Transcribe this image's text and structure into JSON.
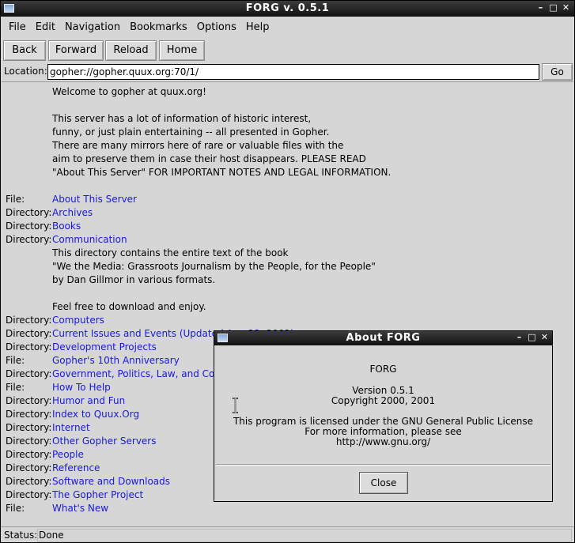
{
  "window": {
    "title": "FORG v. 0.5.1"
  },
  "menu": [
    "File",
    "Edit",
    "Navigation",
    "Bookmarks",
    "Options",
    "Help"
  ],
  "toolbar": {
    "back": "Back",
    "forward": "Forward",
    "reload": "Reload",
    "home": "Home"
  },
  "location": {
    "label": "Location:",
    "value": "gopher://gopher.quux.org:70/1/",
    "go": "Go"
  },
  "content": [
    {
      "kind": "",
      "text": "Welcome to gopher at quux.org!",
      "link": false
    },
    {
      "kind": "",
      "text": "",
      "link": false
    },
    {
      "kind": "",
      "text": "This server has a lot of information of historic interest,",
      "link": false
    },
    {
      "kind": "",
      "text": "funny, or just plain entertaining -- all presented in Gopher.",
      "link": false
    },
    {
      "kind": "",
      "text": "There are many mirrors here of rare or valuable files with the",
      "link": false
    },
    {
      "kind": "",
      "text": "aim to preserve them in case their host disappears.  PLEASE READ",
      "link": false
    },
    {
      "kind": "",
      "text": "\"About This Server\" FOR IMPORTANT NOTES AND LEGAL INFORMATION.",
      "link": false
    },
    {
      "kind": "",
      "text": "",
      "link": false
    },
    {
      "kind": "File:",
      "text": "About This Server",
      "link": true
    },
    {
      "kind": "Directory:",
      "text": "Archives",
      "link": true
    },
    {
      "kind": "Directory:",
      "text": "Books",
      "link": true
    },
    {
      "kind": "Directory:",
      "text": "Communication",
      "link": true
    },
    {
      "kind": "",
      "text": "This directory contains the entire text of the book",
      "link": false
    },
    {
      "kind": "",
      "text": "\"We the Media: Grassroots Journalism by the People, for the People\"",
      "link": false
    },
    {
      "kind": "",
      "text": "by Dan Gillmor in various formats.",
      "link": false
    },
    {
      "kind": "",
      "text": "",
      "link": false
    },
    {
      "kind": "",
      "text": "Feel free to download and enjoy.",
      "link": false
    },
    {
      "kind": "Directory:",
      "text": "Computers",
      "link": true
    },
    {
      "kind": "Directory:",
      "text": "Current Issues and Events (Updated Apr. 23, 2002)",
      "link": true
    },
    {
      "kind": "Directory:",
      "text": "Development Projects",
      "link": true
    },
    {
      "kind": "File:",
      "text": "Gopher's 10th Anniversary",
      "link": true
    },
    {
      "kind": "Directory:",
      "text": "Government, Politics, Law, and Conflict",
      "link": true
    },
    {
      "kind": "File:",
      "text": "How To Help",
      "link": true
    },
    {
      "kind": "Directory:",
      "text": "Humor and Fun",
      "link": true
    },
    {
      "kind": "Directory:",
      "text": "Index to Quux.Org",
      "link": true
    },
    {
      "kind": "Directory:",
      "text": "Internet",
      "link": true
    },
    {
      "kind": "Directory:",
      "text": "Other Gopher Servers",
      "link": true
    },
    {
      "kind": "Directory:",
      "text": "People",
      "link": true
    },
    {
      "kind": "Directory:",
      "text": "Reference",
      "link": true
    },
    {
      "kind": "Directory:",
      "text": "Software and Downloads",
      "link": true
    },
    {
      "kind": "Directory:",
      "text": "The Gopher Project",
      "link": true
    },
    {
      "kind": "File:",
      "text": "What's New",
      "link": true
    }
  ],
  "status": {
    "label": "Status:",
    "value": "Done"
  },
  "dialog": {
    "title": "About FORG",
    "app_name": "FORG",
    "version": "Version 0.5.1",
    "copyright": "Copyright 2000, 2001",
    "license": "This program is licensed under the GNU General Public License",
    "more_info": "For more information, please see",
    "url": "http://www.gnu.org/",
    "close": "Close"
  },
  "colors": {
    "link": "#1818e0",
    "titlebar": "#1a1a1a",
    "background": "#d6d6d6"
  }
}
